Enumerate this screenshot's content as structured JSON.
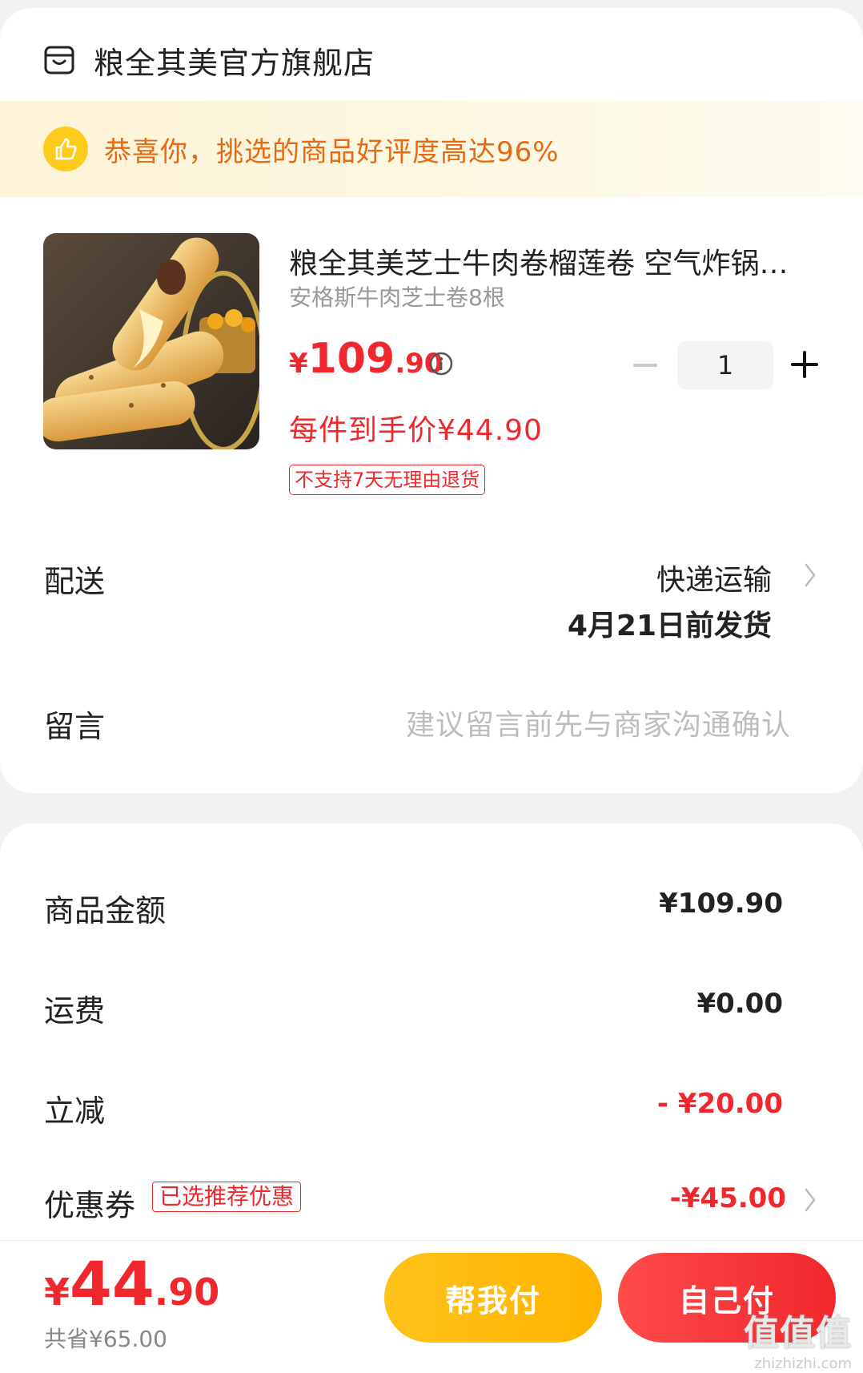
{
  "shop": {
    "name": "粮全其美官方旗舰店"
  },
  "banner": {
    "text": "恭喜你，挑选的商品好评度高达96%"
  },
  "product": {
    "title": "粮全其美芝士牛肉卷榴莲卷 空气炸锅半成品早餐",
    "spec": "安格斯牛肉芝士卷8根",
    "price_currency": "¥",
    "price_int": "109",
    "price_dec": ".90",
    "deal_price": "每件到手价¥44.90",
    "return_tag": "不支持7天无理由退货",
    "quantity": "1"
  },
  "delivery": {
    "label": "配送",
    "method": "快递运输",
    "ship_by": "4月21日前发货"
  },
  "message": {
    "label": "留言",
    "placeholder": "建议留言前先与商家沟通确认"
  },
  "summary": {
    "goods_label": "商品金额",
    "goods_value": "¥109.90",
    "freight_label": "运费",
    "freight_value": "¥0.00",
    "discount_label": "立减",
    "discount_value": "- ¥20.00",
    "coupon_label": "优惠券",
    "coupon_tag": "已选推荐优惠",
    "coupon_value": "-¥45.00"
  },
  "footer": {
    "total_currency": "¥",
    "total_int": "44",
    "total_dec": ".90",
    "saved": "共省¥65.00",
    "help_pay": "帮我付",
    "self_pay": "自己付"
  },
  "watermark": {
    "big": "值值值",
    "small": "zhizhizhi.com"
  },
  "colors": {
    "accent_red": "#f0282d",
    "accent_yellow": "#ffc21a",
    "banner_text": "#e56a12"
  }
}
